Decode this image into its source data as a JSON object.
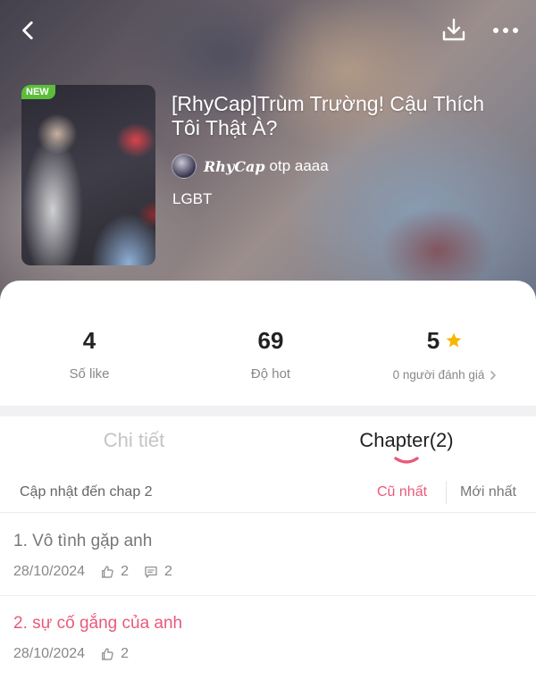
{
  "header": {
    "back_icon": "chevron-left-icon",
    "download_icon": "download-icon",
    "more_icon": "more-horizontal-icon"
  },
  "story": {
    "badge": "NEW",
    "title": "[RhyCap]Trùm Trường! Cậu Thích Tôi Thật À?",
    "author_signature": "RhyCap",
    "author_name": "otp aaaa",
    "genre": "LGBT"
  },
  "stats": {
    "likes": {
      "value": "4",
      "label": "Số like"
    },
    "hot": {
      "value": "69",
      "label": "Độ hot"
    },
    "rating": {
      "value": "5",
      "label": "0 người đánh giá",
      "icon": "star-icon"
    }
  },
  "tabs": {
    "details": "Chi tiết",
    "chapters": "Chapter(2)"
  },
  "sort_bar": {
    "update_text": "Cập nhật đến chap 2",
    "oldest": "Cũ nhất",
    "newest": "Mới nhất"
  },
  "chapters": [
    {
      "title": "1. Vô tình gặp anh",
      "date": "28/10/2024",
      "likes": "2",
      "comments": "2"
    },
    {
      "title": "2. sự cố gắng của anh",
      "date": "28/10/2024",
      "likes": "2"
    }
  ],
  "colors": {
    "accent": "#e85a7a",
    "new_badge": "#5bbd3b",
    "star": "#f5b800"
  }
}
